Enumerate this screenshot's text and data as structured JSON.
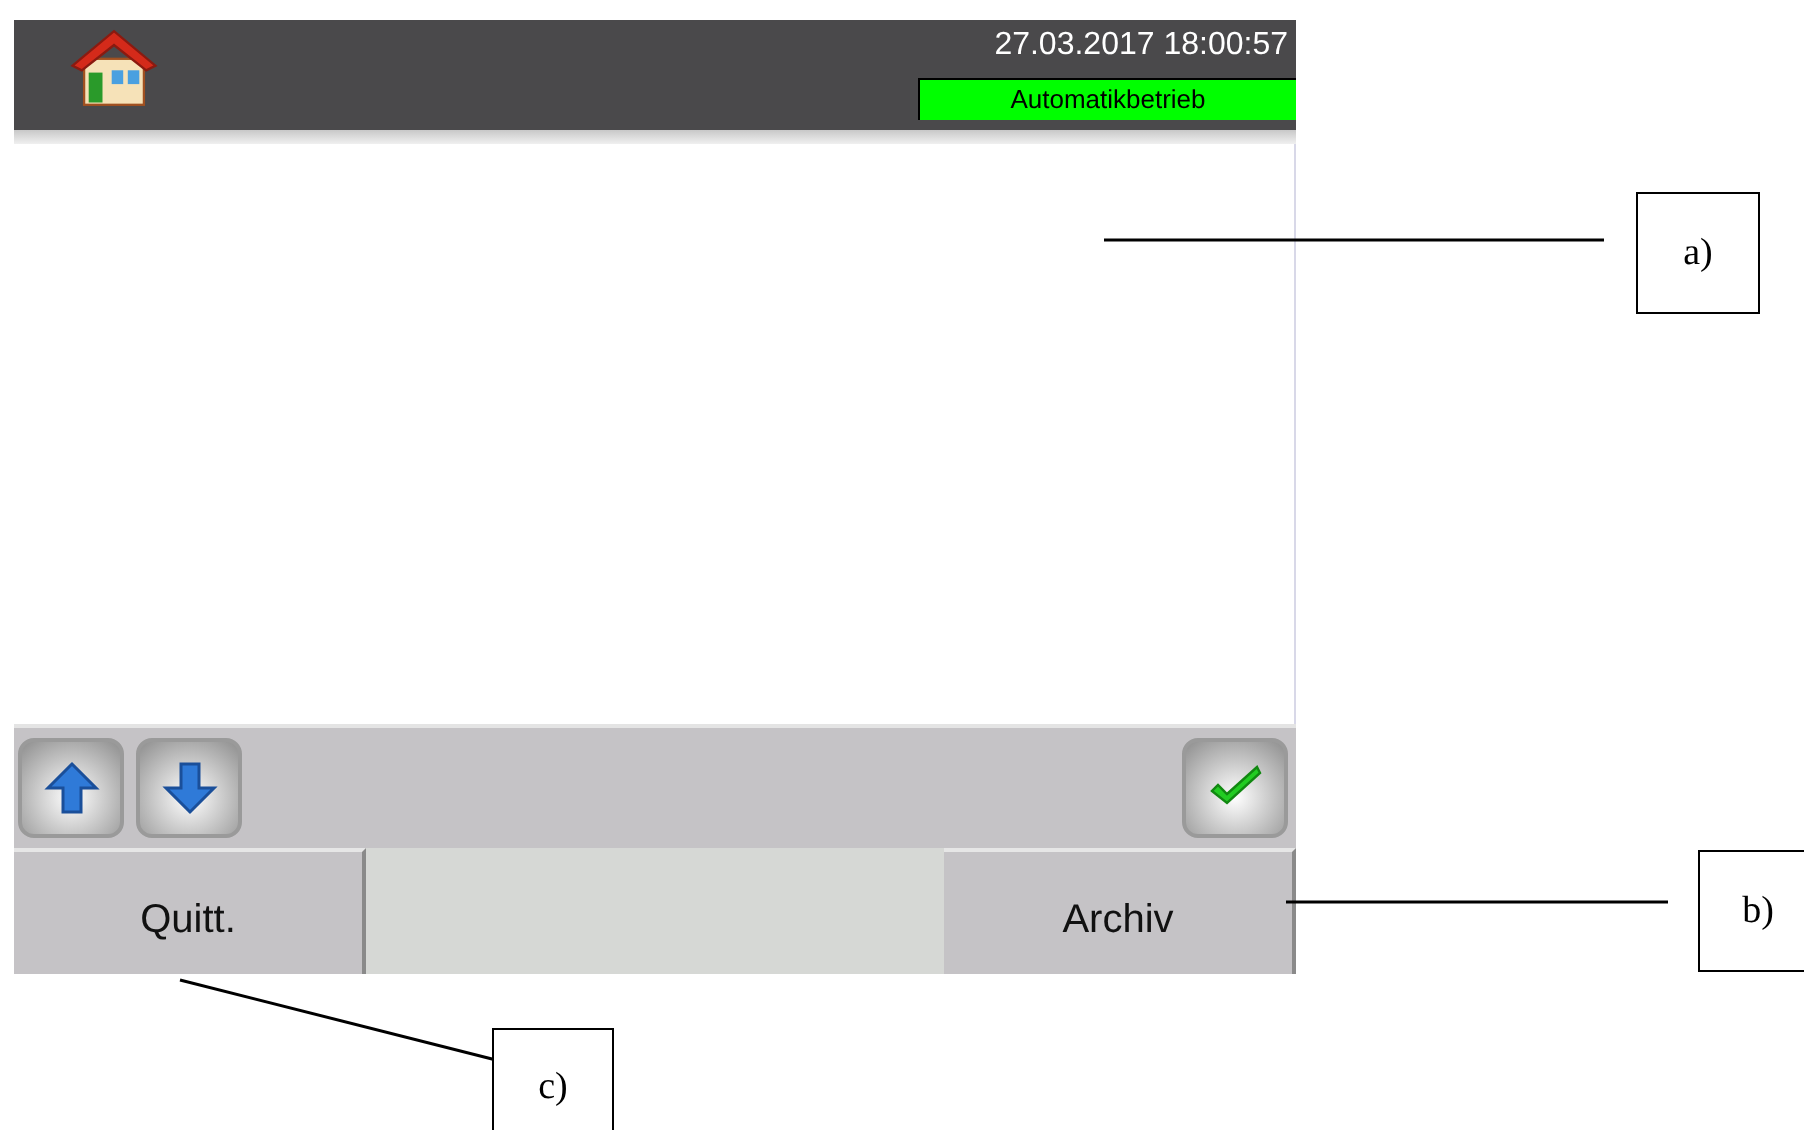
{
  "header": {
    "datetime": "27.03.2017 18:00:57",
    "mode": "Automatikbetrieb"
  },
  "toolbar": [
    {
      "kind": "up"
    },
    {
      "kind": "down"
    },
    {
      "kind": "confirm"
    }
  ],
  "buttons": [
    {
      "label": "Quitt."
    },
    {
      "label": "Archiv"
    }
  ],
  "callouts": [
    {
      "label": "a)"
    },
    {
      "label": "b)"
    },
    {
      "label": "c)"
    }
  ]
}
